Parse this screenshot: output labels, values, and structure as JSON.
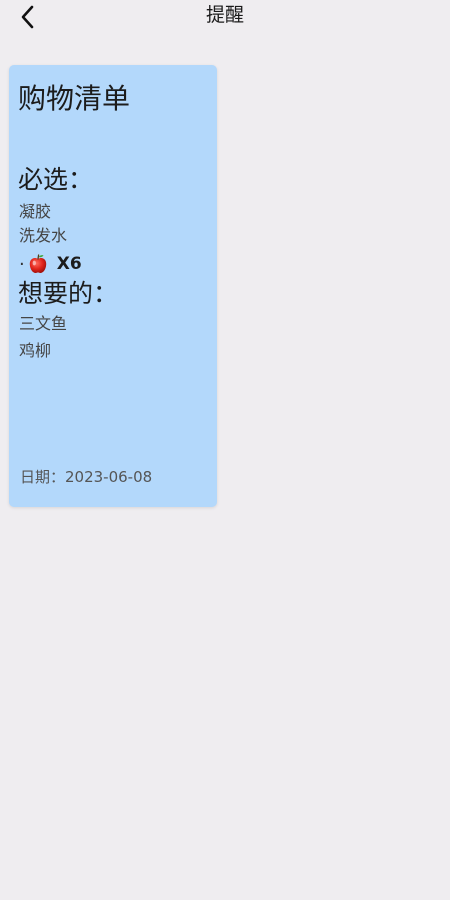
{
  "header": {
    "title": "提醒",
    "back_icon": "chevron-left-icon"
  },
  "note": {
    "background_color": "#b3d8fb",
    "title": "购物清单",
    "required": {
      "heading": "必选：",
      "items": [
        "凝胶",
        "洗发水"
      ],
      "emoji_item": {
        "bullet": "·",
        "icon": "apple-icon",
        "quantity": "X6"
      }
    },
    "wanted": {
      "heading": "想要的：",
      "items": [
        "三文鱼",
        "鸡柳"
      ]
    },
    "date": "日期：2023-06-08"
  }
}
